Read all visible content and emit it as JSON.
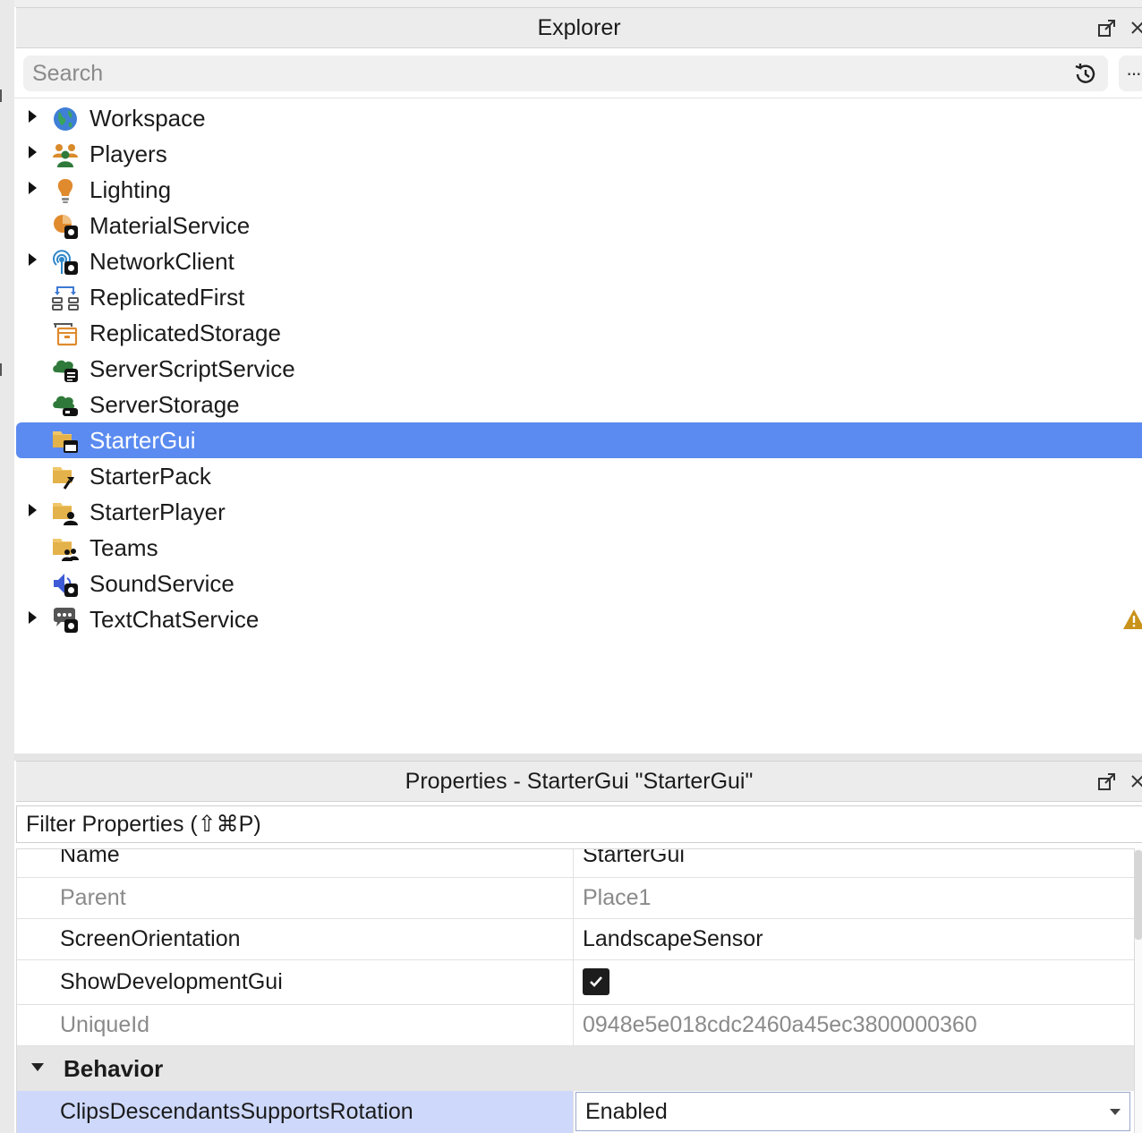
{
  "explorer": {
    "title": "Explorer",
    "search": {
      "placeholder": "Search",
      "value": ""
    },
    "more_label": "···",
    "items": [
      {
        "label": "Workspace",
        "icon": "globe-icon",
        "expandable": true,
        "selected": false
      },
      {
        "label": "Players",
        "icon": "players-icon",
        "expandable": true,
        "selected": false
      },
      {
        "label": "Lighting",
        "icon": "lightbulb-icon",
        "expandable": true,
        "selected": false
      },
      {
        "label": "MaterialService",
        "icon": "material-service-icon",
        "expandable": false,
        "selected": false
      },
      {
        "label": "NetworkClient",
        "icon": "network-client-icon",
        "expandable": true,
        "selected": false
      },
      {
        "label": "ReplicatedFirst",
        "icon": "replicated-first-icon",
        "expandable": false,
        "selected": false
      },
      {
        "label": "ReplicatedStorage",
        "icon": "replicated-storage-icon",
        "expandable": false,
        "selected": false
      },
      {
        "label": "ServerScriptService",
        "icon": "server-script-service-icon",
        "expandable": false,
        "selected": false
      },
      {
        "label": "ServerStorage",
        "icon": "server-storage-icon",
        "expandable": false,
        "selected": false
      },
      {
        "label": "StarterGui",
        "icon": "starter-gui-icon",
        "expandable": false,
        "selected": true
      },
      {
        "label": "StarterPack",
        "icon": "starter-pack-icon",
        "expandable": false,
        "selected": false
      },
      {
        "label": "StarterPlayer",
        "icon": "starter-player-icon",
        "expandable": true,
        "selected": false
      },
      {
        "label": "Teams",
        "icon": "teams-icon",
        "expandable": false,
        "selected": false
      },
      {
        "label": "SoundService",
        "icon": "sound-service-icon",
        "expandable": false,
        "selected": false
      },
      {
        "label": "TextChatService",
        "icon": "text-chat-service-icon",
        "expandable": true,
        "selected": false,
        "warning": true
      }
    ]
  },
  "properties": {
    "title": "Properties - StarterGui \"StarterGui\"",
    "filter": {
      "placeholder": "Filter Properties (⇧⌘P)",
      "value": ""
    },
    "rows": [
      {
        "name": "Name",
        "value": "StarterGui",
        "muted": false,
        "kind": "text"
      },
      {
        "name": "Parent",
        "value": "Place1",
        "muted": true,
        "kind": "text"
      },
      {
        "name": "ScreenOrientation",
        "value": "LandscapeSensor",
        "muted": false,
        "kind": "text"
      },
      {
        "name": "ShowDevelopmentGui",
        "value": "",
        "checked": true,
        "muted": false,
        "kind": "checkbox"
      },
      {
        "name": "UniqueId",
        "value": "0948e5e018cdc2460a45ec3800000360",
        "muted": true,
        "kind": "text"
      }
    ],
    "section": {
      "label": "Behavior",
      "expanded": true
    },
    "section_rows": [
      {
        "name": "ClipsDescendantsSupportsRotation",
        "value": "Enabled",
        "kind": "dropdown",
        "selected": true
      }
    ]
  },
  "colors": {
    "selection": "#5b8bf0",
    "selected_prop_row": "#cdd8fb",
    "warning": "#c9921a"
  }
}
